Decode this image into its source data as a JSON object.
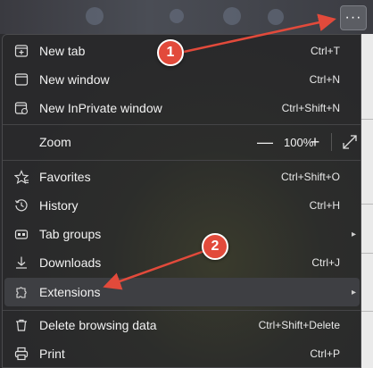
{
  "toolbar": {
    "more_button_label": "···"
  },
  "menu": {
    "new_tab": {
      "label": "New tab",
      "shortcut": "Ctrl+T"
    },
    "new_window": {
      "label": "New window",
      "shortcut": "Ctrl+N"
    },
    "new_inprivate": {
      "label": "New InPrivate window",
      "shortcut": "Ctrl+Shift+N"
    },
    "zoom": {
      "label": "Zoom",
      "minus": "—",
      "value": "100%",
      "plus": "+"
    },
    "favorites": {
      "label": "Favorites",
      "shortcut": "Ctrl+Shift+O"
    },
    "history": {
      "label": "History",
      "shortcut": "Ctrl+H"
    },
    "tab_groups": {
      "label": "Tab groups",
      "chevron": "▸"
    },
    "downloads": {
      "label": "Downloads",
      "shortcut": "Ctrl+J"
    },
    "extensions": {
      "label": "Extensions",
      "chevron": "▸"
    },
    "delete_browsing": {
      "label": "Delete browsing data",
      "shortcut": "Ctrl+Shift+Delete"
    },
    "print": {
      "label": "Print",
      "shortcut": "Ctrl+P"
    }
  },
  "annotations": {
    "step1": "1",
    "step2": "2",
    "color": "#e24a3b"
  },
  "colors": {
    "menu_bg": "#2c2c2e",
    "text": "#f2f2f2",
    "highlight": "#3e3f43"
  }
}
